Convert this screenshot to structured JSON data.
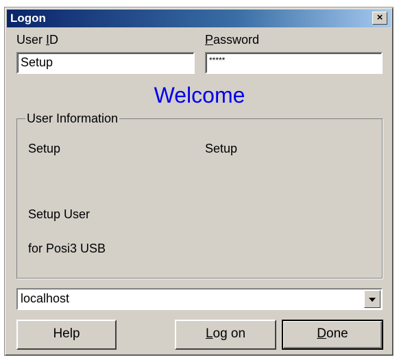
{
  "window": {
    "title": "Logon",
    "close_label": "×"
  },
  "labels": {
    "user_id": {
      "prefix": "User ",
      "accel": "I",
      "suffix": "D"
    },
    "password": {
      "prefix": "",
      "accel": "P",
      "suffix": "assword"
    }
  },
  "fields": {
    "user_id_value": "Setup",
    "password_value": "*****"
  },
  "welcome": "Welcome",
  "user_information": {
    "legend": "User Information",
    "field_left_1": "Setup",
    "field_right_1": "Setup",
    "full_name": "Setup User",
    "description": "for Posi3 USB"
  },
  "server": {
    "selected": "localhost"
  },
  "buttons": {
    "help": "Help",
    "logon": {
      "prefix": "",
      "accel": "L",
      "suffix": "og on"
    },
    "done": {
      "prefix": "",
      "accel": "D",
      "suffix": "one"
    }
  }
}
